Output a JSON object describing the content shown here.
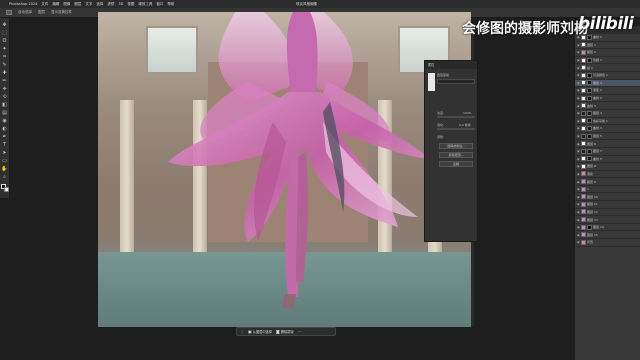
{
  "menubar": {
    "app_name": "Photoshop 2024",
    "items": [
      "文件",
      "编辑",
      "图像",
      "图层",
      "文字",
      "选择",
      "滤镜",
      "3D",
      "视图",
      "增效工具",
      "窗口",
      "帮助"
    ],
    "window_title": "现实风格蝴蝶"
  },
  "optionsbar": {
    "items": [
      "自动选择",
      "图层",
      "显示变换控件"
    ]
  },
  "doc_tab": {
    "label": ""
  },
  "toolbar": {
    "tools": [
      "move-icon",
      "marquee-icon",
      "lasso-icon",
      "magic-wand-icon",
      "crop-icon",
      "eyedropper-icon",
      "healing-icon",
      "brush-icon",
      "stamp-icon",
      "history-brush-icon",
      "eraser-icon",
      "gradient-icon",
      "blur-icon",
      "dodge-icon",
      "pen-icon",
      "type-icon",
      "path-select-icon",
      "shape-icon",
      "hand-icon",
      "zoom-icon"
    ],
    "glyphs": [
      "✥",
      "⬚",
      "ʘ",
      "✦",
      "⌗",
      "✎",
      "✚",
      "✏",
      "⎈",
      "⟲",
      "◧",
      "▤",
      "◉",
      "◐",
      "✒",
      "T",
      "➤",
      "▭",
      "✋",
      "⌕"
    ]
  },
  "taskbar": {
    "btn1": "从图层中选择",
    "btn2": "删除蒙版",
    "icons": [
      "◻",
      "◻",
      "◻",
      "◻"
    ]
  },
  "properties": {
    "title": "属性",
    "tabs": [
      "蒙版",
      "像素"
    ],
    "mask_label": "图层蒙版",
    "density_label": "浓度:",
    "density_value": "100%",
    "feather_label": "羽化:",
    "feather_value": "0.0 像素",
    "refine_label": "调整:",
    "btn_select_mask": "选择并遮住...",
    "btn_color_range": "颜色范围...",
    "btn_invert": "反相"
  },
  "layers": {
    "header": "图层",
    "items": [
      {
        "name": "曲线 1",
        "thumb": "white",
        "mask": true
      },
      {
        "name": "图层 1",
        "thumb": "white",
        "mask": false
      },
      {
        "name": "图层 2",
        "thumb": "pink",
        "mask": false
      },
      {
        "name": "色相 1",
        "thumb": "white",
        "mask": true
      },
      {
        "name": "组 1",
        "thumb": "white",
        "mask": false
      },
      {
        "name": "可选颜色 1",
        "thumb": "white",
        "mask": true
      },
      {
        "name": "图层 3",
        "thumb": "white",
        "mask": true,
        "selected": true
      },
      {
        "name": "渐变 1",
        "thumb": "white",
        "mask": true
      },
      {
        "name": "曲线 2",
        "thumb": "white",
        "mask": true
      },
      {
        "name": "曲线 3",
        "thumb": "white",
        "mask": false
      },
      {
        "name": "图层 4",
        "thumb": "dark",
        "mask": true
      },
      {
        "name": "色彩平衡 1",
        "thumb": "white",
        "mask": true
      },
      {
        "name": "曲线 4",
        "thumb": "white",
        "mask": true
      },
      {
        "name": "图层 5",
        "thumb": "dark",
        "mask": true
      },
      {
        "name": "图层 6",
        "thumb": "white",
        "mask": false
      },
      {
        "name": "图层 7",
        "thumb": "dark",
        "mask": true
      },
      {
        "name": "曲线 5",
        "thumb": "white",
        "mask": true
      },
      {
        "name": "图层 8",
        "thumb": "white",
        "mask": false
      },
      {
        "name": "液化",
        "thumb": "pink",
        "mask": false
      },
      {
        "name": "图层 9",
        "thumb": "pink",
        "mask": false
      },
      {
        "name": "1",
        "thumb": "pink",
        "mask": false
      },
      {
        "name": "图层 10",
        "thumb": "pink",
        "mask": false
      },
      {
        "name": "图层 11",
        "thumb": "pink",
        "mask": false
      },
      {
        "name": "图层 12",
        "thumb": "pink",
        "mask": false
      },
      {
        "name": "图层 13",
        "thumb": "pink",
        "mask": false
      },
      {
        "name": "图层 14",
        "thumb": "pink",
        "mask": true
      },
      {
        "name": "图层 15",
        "thumb": "pink",
        "mask": false
      },
      {
        "name": "背景",
        "thumb": "pink",
        "mask": false
      }
    ]
  },
  "watermark": {
    "text": "会修图的摄影师刘杨",
    "logo": "bilibili"
  }
}
